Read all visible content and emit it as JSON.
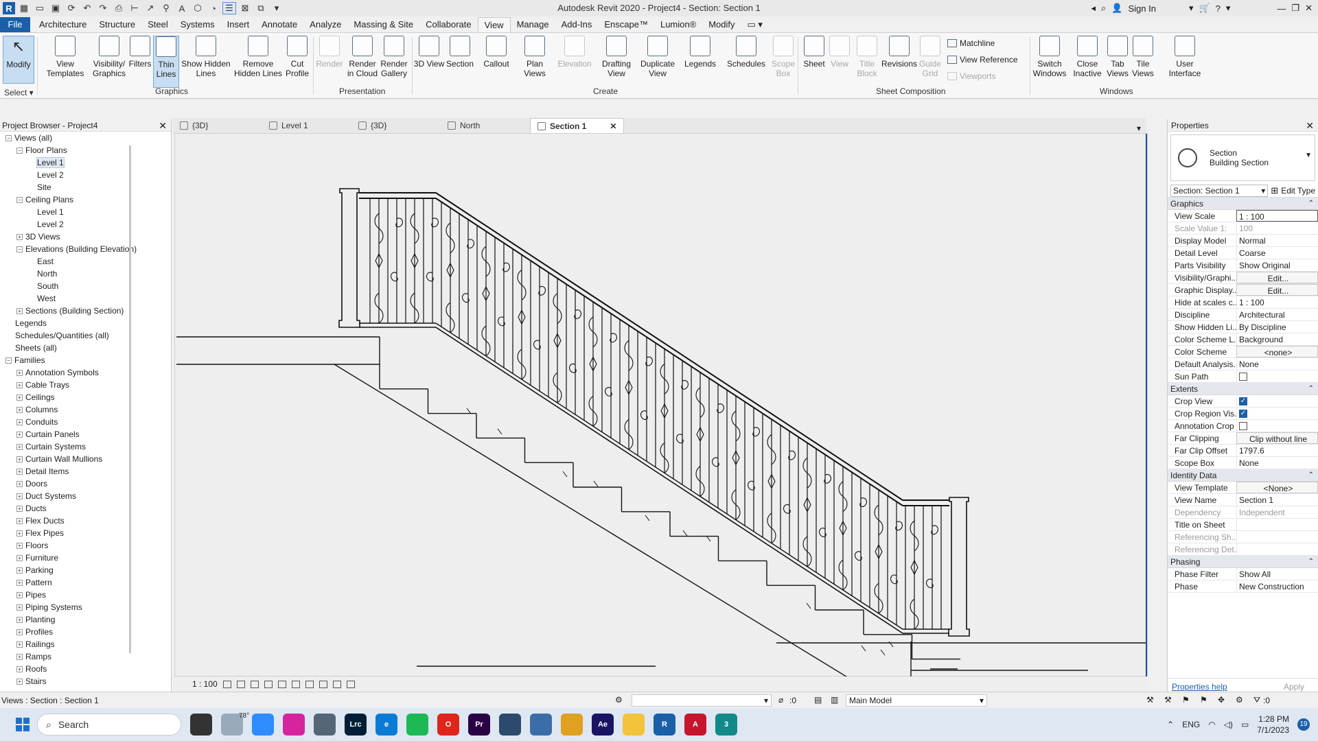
{
  "app": {
    "title": "Autodesk Revit 2020 - Project4 - Section: Section 1",
    "sign_in": "Sign In",
    "logo": "R"
  },
  "ribbon_tabs": [
    "File",
    "Architecture",
    "Structure",
    "Steel",
    "Systems",
    "Insert",
    "Annotate",
    "Analyze",
    "Massing & Site",
    "Collaborate",
    "View",
    "Manage",
    "Add-Ins",
    "Enscape™",
    "Lumion®",
    "Modify"
  ],
  "ribbon": {
    "modify": "Modify",
    "select": "Select ▾",
    "graphics_buttons": [
      "View Templates",
      "Visibility/ Graphics",
      "Filters",
      "Thin Lines",
      "Show Hidden Lines",
      "Remove Hidden Lines",
      "Cut Profile"
    ],
    "graphics_label": "Graphics",
    "presentation_buttons": [
      "Render",
      "Render in Cloud",
      "Render Gallery"
    ],
    "presentation_label": "Presentation",
    "create_buttons": [
      "3D View",
      "Section",
      "Callout",
      "Plan Views",
      "Elevation",
      "Drafting View",
      "Duplicate View",
      "Legends",
      "Schedules",
      "Scope Box"
    ],
    "create_label": "Create",
    "sheet_buttons": [
      "Sheet",
      "View",
      "Title Block",
      "Revisions",
      "Guide Grid"
    ],
    "sheet_small": [
      "Matchline",
      "View Reference",
      "Viewports"
    ],
    "sheet_label": "Sheet Composition",
    "window_buttons": [
      "Switch Windows",
      "Close Inactive",
      "Tab Views",
      "Tile Views"
    ],
    "ui_button": "User Interface",
    "windows_label": "Windows"
  },
  "project_browser": {
    "title": "Project Browser - Project4",
    "tree": [
      {
        "label": "Views (all)",
        "lvl": 0,
        "pm": "−"
      },
      {
        "label": "Floor Plans",
        "lvl": 1,
        "pm": "−"
      },
      {
        "label": "Level 1",
        "lvl": 2,
        "pm": "",
        "hl": true
      },
      {
        "label": "Level 2",
        "lvl": 2,
        "pm": ""
      },
      {
        "label": "Site",
        "lvl": 2,
        "pm": ""
      },
      {
        "label": "Ceiling Plans",
        "lvl": 1,
        "pm": "−"
      },
      {
        "label": "Level 1",
        "lvl": 2,
        "pm": ""
      },
      {
        "label": "Level 2",
        "lvl": 2,
        "pm": ""
      },
      {
        "label": "3D Views",
        "lvl": 1,
        "pm": "+"
      },
      {
        "label": "Elevations (Building Elevation)",
        "lvl": 1,
        "pm": "−"
      },
      {
        "label": "East",
        "lvl": 2,
        "pm": ""
      },
      {
        "label": "North",
        "lvl": 2,
        "pm": ""
      },
      {
        "label": "South",
        "lvl": 2,
        "pm": ""
      },
      {
        "label": "West",
        "lvl": 2,
        "pm": ""
      },
      {
        "label": "Sections (Building Section)",
        "lvl": 1,
        "pm": "+"
      },
      {
        "label": "Legends",
        "lvl": 0,
        "pm": ""
      },
      {
        "label": "Schedules/Quantities (all)",
        "lvl": 0,
        "pm": ""
      },
      {
        "label": "Sheets (all)",
        "lvl": 0,
        "pm": ""
      },
      {
        "label": "Families",
        "lvl": 0,
        "pm": "−"
      },
      {
        "label": "Annotation Symbols",
        "lvl": 1,
        "pm": "+"
      },
      {
        "label": "Cable Trays",
        "lvl": 1,
        "pm": "+"
      },
      {
        "label": "Ceilings",
        "lvl": 1,
        "pm": "+"
      },
      {
        "label": "Columns",
        "lvl": 1,
        "pm": "+"
      },
      {
        "label": "Conduits",
        "lvl": 1,
        "pm": "+"
      },
      {
        "label": "Curtain Panels",
        "lvl": 1,
        "pm": "+"
      },
      {
        "label": "Curtain Systems",
        "lvl": 1,
        "pm": "+"
      },
      {
        "label": "Curtain Wall Mullions",
        "lvl": 1,
        "pm": "+"
      },
      {
        "label": "Detail Items",
        "lvl": 1,
        "pm": "+"
      },
      {
        "label": "Doors",
        "lvl": 1,
        "pm": "+"
      },
      {
        "label": "Duct Systems",
        "lvl": 1,
        "pm": "+"
      },
      {
        "label": "Ducts",
        "lvl": 1,
        "pm": "+"
      },
      {
        "label": "Flex Ducts",
        "lvl": 1,
        "pm": "+"
      },
      {
        "label": "Flex Pipes",
        "lvl": 1,
        "pm": "+"
      },
      {
        "label": "Floors",
        "lvl": 1,
        "pm": "+"
      },
      {
        "label": "Furniture",
        "lvl": 1,
        "pm": "+"
      },
      {
        "label": "Parking",
        "lvl": 1,
        "pm": "+"
      },
      {
        "label": "Pattern",
        "lvl": 1,
        "pm": "+"
      },
      {
        "label": "Pipes",
        "lvl": 1,
        "pm": "+"
      },
      {
        "label": "Piping Systems",
        "lvl": 1,
        "pm": "+"
      },
      {
        "label": "Planting",
        "lvl": 1,
        "pm": "+"
      },
      {
        "label": "Profiles",
        "lvl": 1,
        "pm": "+"
      },
      {
        "label": "Railings",
        "lvl": 1,
        "pm": "+"
      },
      {
        "label": "Ramps",
        "lvl": 1,
        "pm": "+"
      },
      {
        "label": "Roofs",
        "lvl": 1,
        "pm": "+"
      },
      {
        "label": "Stairs",
        "lvl": 1,
        "pm": "+"
      }
    ]
  },
  "view_tabs": [
    {
      "label": "{3D}",
      "active": false
    },
    {
      "label": "Level 1",
      "active": false
    },
    {
      "label": "{3D}",
      "active": false
    },
    {
      "label": "North",
      "active": false
    },
    {
      "label": "Section 1",
      "active": true
    }
  ],
  "view_control": {
    "scale": "1 : 100"
  },
  "properties": {
    "title": "Properties",
    "type_name": "Section",
    "type_sub": "Building Section",
    "selector": "Section: Section 1",
    "edit_type": "Edit Type",
    "groups": [
      {
        "name": "Graphics",
        "rows": [
          {
            "k": "View Scale",
            "v": "1 : 100",
            "style": "boxed"
          },
          {
            "k": "Scale Value    1:",
            "v": "100",
            "dim": true
          },
          {
            "k": "Display Model",
            "v": "Normal"
          },
          {
            "k": "Detail Level",
            "v": "Coarse"
          },
          {
            "k": "Parts Visibility",
            "v": "Show Original"
          },
          {
            "k": "Visibility/Graphi...",
            "v": "Edit...",
            "style": "btn"
          },
          {
            "k": "Graphic Display...",
            "v": "Edit...",
            "style": "btn"
          },
          {
            "k": "Hide at scales c...",
            "v": "1 : 100"
          },
          {
            "k": "Discipline",
            "v": "Architectural"
          },
          {
            "k": "Show Hidden Li...",
            "v": "By Discipline"
          },
          {
            "k": "Color Scheme L...",
            "v": "Background"
          },
          {
            "k": "Color Scheme",
            "v": "<none>",
            "style": "btn"
          },
          {
            "k": "Default Analysis...",
            "v": "None"
          },
          {
            "k": "Sun Path",
            "v": "",
            "cb": "off"
          }
        ]
      },
      {
        "name": "Extents",
        "rows": [
          {
            "k": "Crop View",
            "v": "",
            "cb": "on"
          },
          {
            "k": "Crop Region Vis...",
            "v": "",
            "cb": "on"
          },
          {
            "k": "Annotation Crop",
            "v": "",
            "cb": "off"
          },
          {
            "k": "Far Clipping",
            "v": "Clip without line",
            "style": "btn"
          },
          {
            "k": "Far Clip Offset",
            "v": "1797.6"
          },
          {
            "k": "Scope Box",
            "v": "None"
          }
        ]
      },
      {
        "name": "Identity Data",
        "rows": [
          {
            "k": "View Template",
            "v": "<None>",
            "style": "btn"
          },
          {
            "k": "View Name",
            "v": "Section 1"
          },
          {
            "k": "Dependency",
            "v": "Independent",
            "dim": true
          },
          {
            "k": "Title on Sheet",
            "v": ""
          },
          {
            "k": "Referencing Sh...",
            "v": "",
            "dim": true
          },
          {
            "k": "Referencing Det...",
            "v": "",
            "dim": true
          }
        ]
      },
      {
        "name": "Phasing",
        "rows": [
          {
            "k": "Phase Filter",
            "v": "Show All"
          },
          {
            "k": "Phase",
            "v": "New Construction"
          }
        ]
      }
    ],
    "help_link": "Properties help",
    "apply": "Apply"
  },
  "status": {
    "text": "Views : Section : Section 1",
    "zero": ":0",
    "model": "Main Model",
    "filter": ":0"
  },
  "taskbar": {
    "search": "Search",
    "weather": "78°",
    "lang": "ENG",
    "time": "1:28 PM",
    "date": "7/1/2023",
    "notif": "19",
    "apps": [
      {
        "name": "file-explorer-dark",
        "color": "#333333",
        "label": ""
      },
      {
        "name": "weather",
        "color": "#9ab",
        "label": ""
      },
      {
        "name": "zoom",
        "color": "#2d8cff",
        "label": ""
      },
      {
        "name": "instagram",
        "color": "#d6249f",
        "label": ""
      },
      {
        "name": "app-chart",
        "color": "#567",
        "label": ""
      },
      {
        "name": "lightroom",
        "color": "#001e36",
        "label": "Lrc"
      },
      {
        "name": "edge",
        "color": "#0c7bd6",
        "label": "e"
      },
      {
        "name": "spotify",
        "color": "#1db954",
        "label": ""
      },
      {
        "name": "opera",
        "color": "#e0261b",
        "label": "O"
      },
      {
        "name": "premiere",
        "color": "#2a0044",
        "label": "Pr"
      },
      {
        "name": "sketchup",
        "color": "#2b4a6e",
        "label": ""
      },
      {
        "name": "app-blue",
        "color": "#3b6ea8",
        "label": ""
      },
      {
        "name": "media",
        "color": "#e0a020",
        "label": ""
      },
      {
        "name": "after-effects",
        "color": "#1b1464",
        "label": "Ae"
      },
      {
        "name": "folder",
        "color": "#f4c33d",
        "label": ""
      },
      {
        "name": "revit",
        "color": "#1b5fa8",
        "label": "R"
      },
      {
        "name": "autocad",
        "color": "#c6162e",
        "label": "A"
      },
      {
        "name": "3dsmax",
        "color": "#128a8a",
        "label": "3"
      }
    ]
  }
}
